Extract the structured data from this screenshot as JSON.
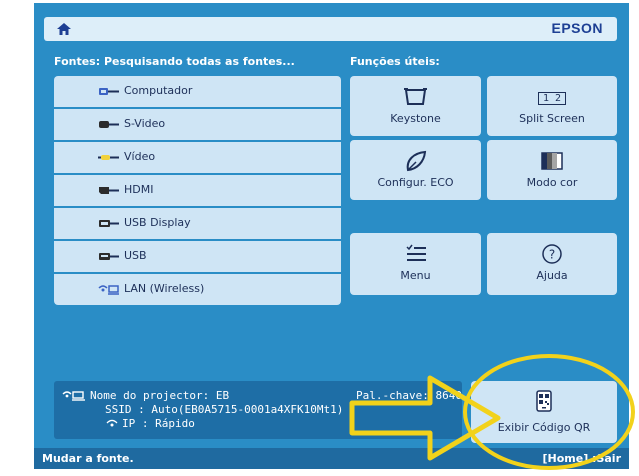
{
  "header": {
    "brand": "EPSON"
  },
  "sources": {
    "heading": "Fontes: Pesquisando todas as fontes...",
    "items": [
      {
        "label": "Computador",
        "icon": "computer-port-icon"
      },
      {
        "label": "S-Video",
        "icon": "svideo-port-icon"
      },
      {
        "label": "Vídeo",
        "icon": "video-port-icon"
      },
      {
        "label": "HDMI",
        "icon": "hdmi-port-icon"
      },
      {
        "label": "USB Display",
        "icon": "usb-display-port-icon"
      },
      {
        "label": "USB",
        "icon": "usb-port-icon"
      },
      {
        "label": "LAN (Wireless)",
        "icon": "wireless-lan-icon"
      }
    ]
  },
  "functions": {
    "heading": "Funções úteis:",
    "keystone": "Keystone",
    "split_screen": "Split Screen",
    "split_icon_text": "1 2",
    "eco": "Configur. ECO",
    "color_mode": "Modo cor",
    "menu": "Menu",
    "help": "Ajuda"
  },
  "info": {
    "line1": "Nome do projector: EB",
    "line1_right": "Pal.-chave: 8640",
    "line2": "SSID : Auto(EB0A5715-0001a4XFK10Mt1)",
    "line3": "IP : Rápido"
  },
  "qr": {
    "label": "Exibir Código QR"
  },
  "status": {
    "left": "Mudar a fonte.",
    "right": "[Home] :Sair"
  },
  "colors": {
    "screen_bg": "#2a8dc6",
    "tile_bg": "#cfe5f5",
    "brand": "#1d3f94",
    "annotation": "#f2d21b"
  }
}
